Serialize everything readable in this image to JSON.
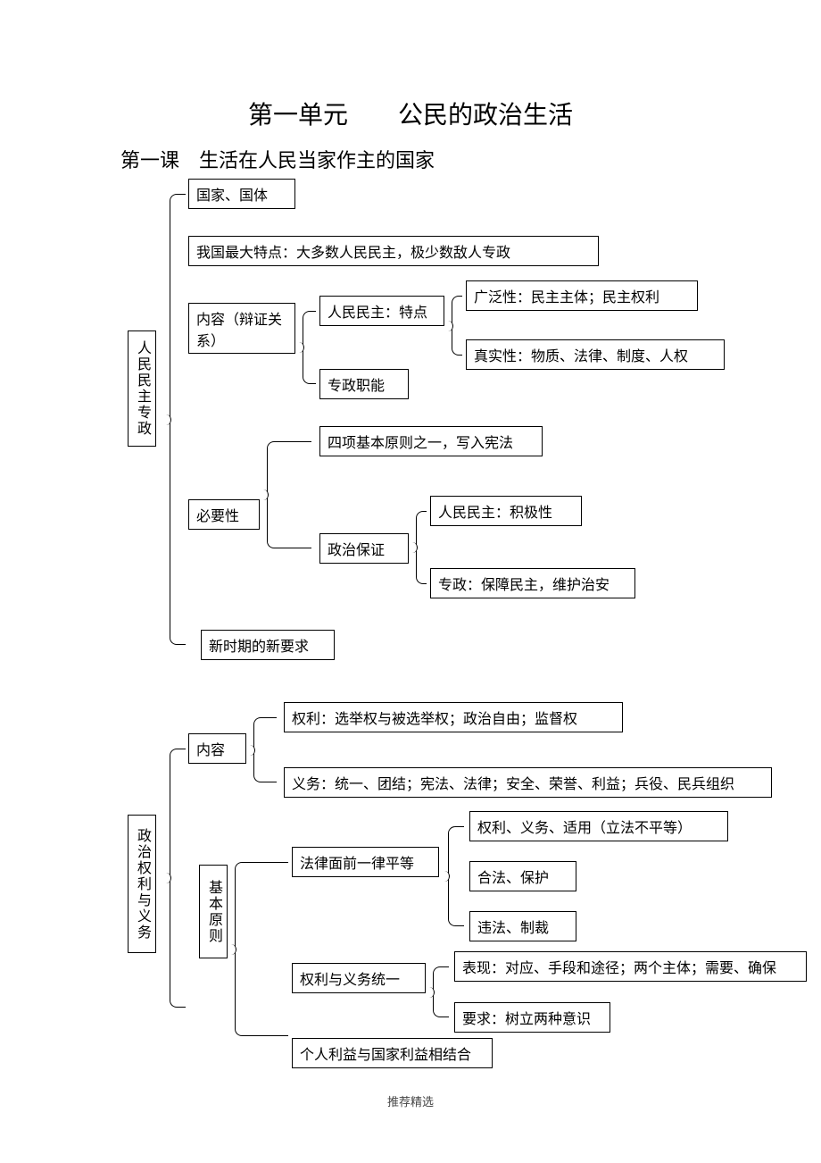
{
  "title": "第一单元　　公民的政治生活",
  "subtitle": "第一课　生活在人民当家作主的国家",
  "tree1": {
    "root": "人民民主专政",
    "n1": "国家、国体",
    "n2": "我国最大特点：大多数人民民主，极少数敌人专政",
    "n3": "内容（辩证关系）",
    "n3a": "人民民主：特点",
    "n3a1": "广泛性：民主主体；民主权利",
    "n3a2": "真实性：物质、法律、制度、人权",
    "n3b": "专政职能",
    "n4": "必要性",
    "n4a": "四项基本原则之一，写入宪法",
    "n4b": "政治保证",
    "n4b1": "人民民主：积极性",
    "n4b2": "专政：保障民主，维护治安",
    "n5": "新时期的新要求"
  },
  "tree2": {
    "root": "政治权利与义务",
    "n1": "内容",
    "n1a": "权利：选举权与被选举权；政治自由；监督权",
    "n1b": "义务：统一、团结；宪法、法律；安全、荣誉、利益；兵役、民兵组织",
    "n2": "基本原则",
    "n2a": "法律面前一律平等",
    "n2a1": "权利、义务、适用（立法不平等）",
    "n2a2": "合法、保护",
    "n2a3": "违法、制裁",
    "n2b": "权利与义务统一",
    "n2b1": "表现：对应、手段和途径；两个主体；需要、确保",
    "n2b2": "要求：树立两种意识",
    "n2c": "个人利益与国家利益相结合"
  },
  "footer": "推荐精选"
}
